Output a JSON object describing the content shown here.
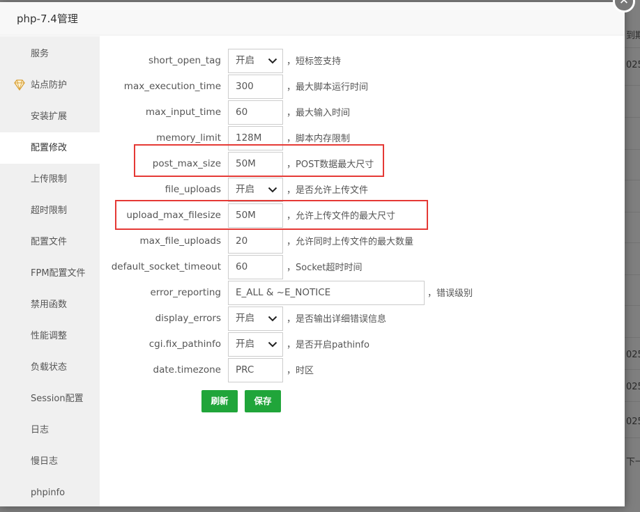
{
  "modal": {
    "title": "php-7.4管理",
    "close_icon": "close-icon"
  },
  "background": {
    "texts": [
      "到期时",
      "025",
      "025",
      "025",
      "025",
      "下一"
    ]
  },
  "sidebar": {
    "items": [
      {
        "label": "服务"
      },
      {
        "label": "站点防护",
        "icon": "shield-diamond-icon"
      },
      {
        "label": "安装扩展"
      },
      {
        "label": "配置修改",
        "active": true
      },
      {
        "label": "上传限制"
      },
      {
        "label": "超时限制"
      },
      {
        "label": "配置文件"
      },
      {
        "label": "FPM配置文件"
      },
      {
        "label": "禁用函数"
      },
      {
        "label": "性能调整"
      },
      {
        "label": "负载状态"
      },
      {
        "label": "Session配置"
      },
      {
        "label": "日志"
      },
      {
        "label": "慢日志"
      },
      {
        "label": "phpinfo"
      }
    ]
  },
  "config": {
    "rows": [
      {
        "name": "short_open_tag",
        "type": "select",
        "value": "开启",
        "desc": "，短标签支持"
      },
      {
        "name": "max_execution_time",
        "type": "text",
        "value": "300",
        "desc": "，最大脚本运行时间"
      },
      {
        "name": "max_input_time",
        "type": "text",
        "value": "60",
        "desc": "，最大输入时间"
      },
      {
        "name": "memory_limit",
        "type": "text",
        "value": "128M",
        "desc": "，脚本内存限制"
      },
      {
        "name": "post_max_size",
        "type": "text",
        "value": "50M",
        "desc": "，POST数据最大尺寸"
      },
      {
        "name": "file_uploads",
        "type": "select",
        "value": "开启",
        "desc": "，是否允许上传文件"
      },
      {
        "name": "upload_max_filesize",
        "type": "text",
        "value": "50M",
        "desc": "，允许上传文件的最大尺寸"
      },
      {
        "name": "max_file_uploads",
        "type": "text",
        "value": "20",
        "desc": "，允许同时上传文件的最大数量"
      },
      {
        "name": "default_socket_timeout",
        "type": "text",
        "value": "60",
        "desc": "，Socket超时时间"
      },
      {
        "name": "error_reporting",
        "type": "wide",
        "value": "E_ALL & ~E_NOTICE",
        "desc": "，错误级别"
      },
      {
        "name": "display_errors",
        "type": "select",
        "value": "开启",
        "desc": "，是否输出详细错误信息"
      },
      {
        "name": "cgi.fix_pathinfo",
        "type": "select",
        "value": "开启",
        "desc": "，是否开启pathinfo"
      },
      {
        "name": "date.timezone",
        "type": "text",
        "value": "PRC",
        "desc": "，时区"
      }
    ],
    "refresh_label": "刷新",
    "save_label": "保存"
  },
  "colors": {
    "accent_green": "#20a53a",
    "highlight_red": "#e53935",
    "sidebar_bg": "#f0f0f0"
  }
}
